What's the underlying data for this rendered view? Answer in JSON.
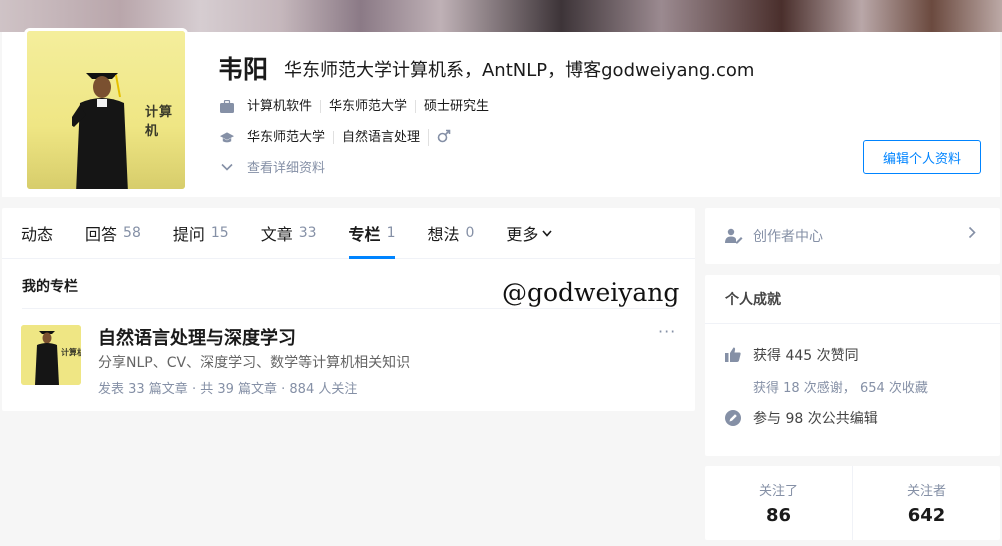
{
  "profile": {
    "name": "韦阳",
    "headline": "华东师范大学计算机系，AntNLP，博客godweiyang.com",
    "industry": "计算机软件",
    "company": "华东师范大学",
    "position": "硕士研究生",
    "school": "华东师范大学",
    "major": "自然语言处理",
    "gender_icon": "male-icon",
    "detail_link": "查看详细资料",
    "edit_button": "编辑个人资料",
    "avatar_wall_text": "计算机"
  },
  "tabs": [
    {
      "label": "动态",
      "count": ""
    },
    {
      "label": "回答",
      "count": "58"
    },
    {
      "label": "提问",
      "count": "15"
    },
    {
      "label": "文章",
      "count": "33"
    },
    {
      "label": "专栏",
      "count": "1"
    },
    {
      "label": "想法",
      "count": "0"
    },
    {
      "label": "更多",
      "count": ""
    }
  ],
  "active_tab": "专栏",
  "section_title": "我的专栏",
  "watermark": "@godweiyang",
  "column": {
    "title": "自然语言处理与深度学习",
    "description": "分享NLP、CV、深度学习、数学等计算机相关知识",
    "meta": "发表 33 篇文章 · 共 39 篇文章 · 884 人关注",
    "more": "···",
    "thumb_text": "计算机"
  },
  "creator_center": {
    "label": "创作者中心"
  },
  "achievements": {
    "title": "个人成就",
    "likes": "获得 445 次赞同",
    "thanks_favs": "获得 18 次感谢， 654 次收藏",
    "edits": "参与 98 次公共编辑"
  },
  "follow": {
    "following_label": "关注了",
    "following_count": "86",
    "followers_label": "关注者",
    "followers_count": "642"
  },
  "colors": {
    "accent": "#0084ff",
    "muted": "#8590a6",
    "background": "#f6f6f6"
  }
}
